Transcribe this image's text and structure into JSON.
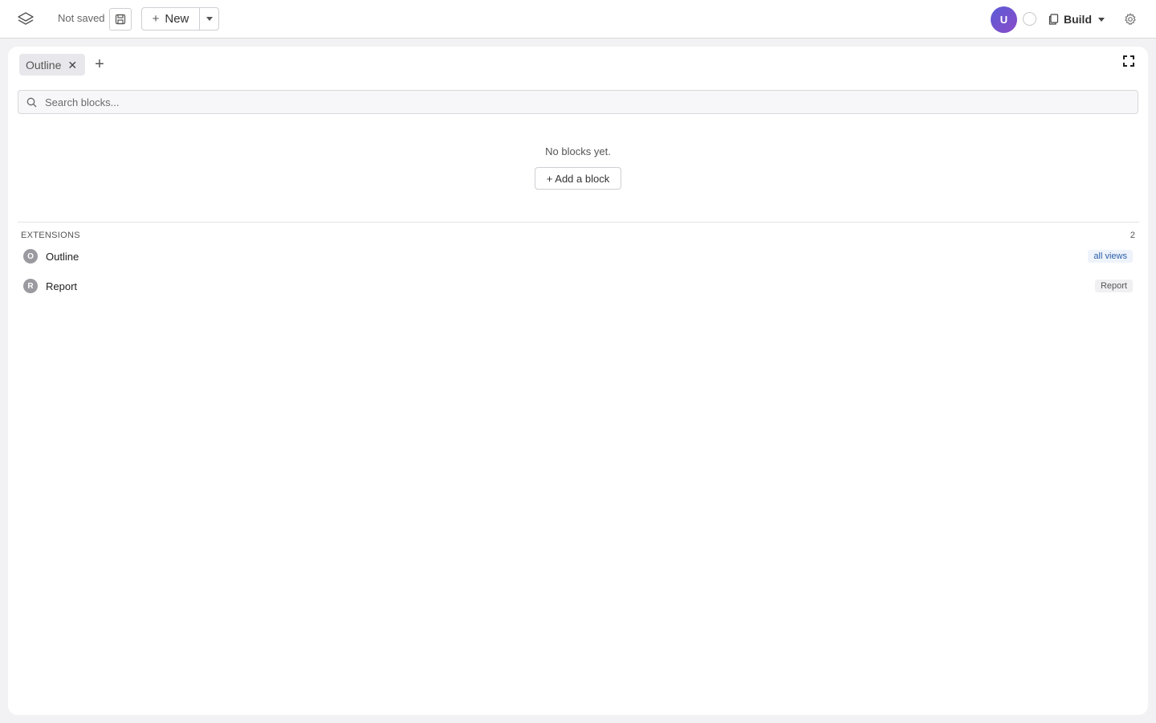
{
  "topbar": {
    "save_status": "Not saved",
    "new_label": "New",
    "avatar_initial": "U",
    "build_label": "Build"
  },
  "tabs": [
    {
      "label": "Outline"
    }
  ],
  "search": {
    "placeholder": "Search blocks..."
  },
  "main": {
    "empty_message": "No blocks yet.",
    "add_block_label": "+ Add a block"
  },
  "extensions": {
    "header": "EXTENSIONS",
    "count": "2",
    "items": [
      {
        "letter": "O",
        "name": "Outline",
        "tag": "all views"
      },
      {
        "letter": "R",
        "name": "Report",
        "tag": "Report"
      }
    ]
  },
  "colors": {
    "accent": "#5b5bd6",
    "tag_blue_text": "#2b5ea8"
  }
}
